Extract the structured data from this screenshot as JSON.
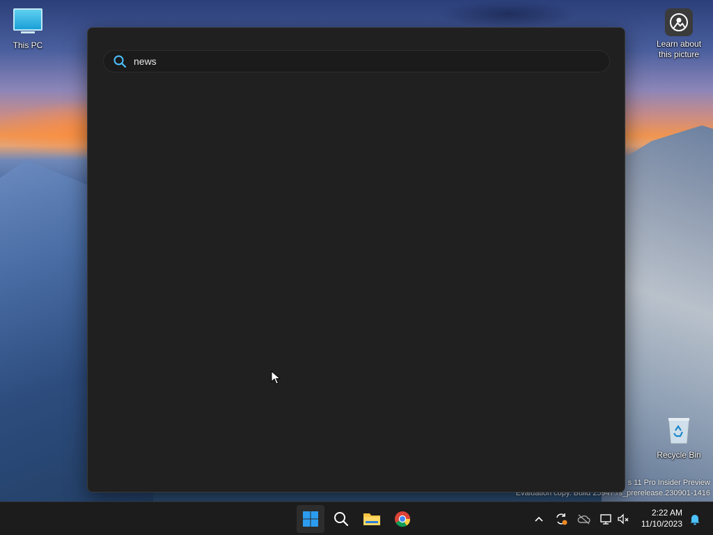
{
  "desktop": {
    "icons": {
      "this_pc": "This PC",
      "learn_line1": "Learn about",
      "learn_line2": "this picture",
      "recycle_bin": "Recycle Bin"
    },
    "watermark": {
      "line1": "s 11 Pro Insider Preview",
      "line2": "Evaluation copy. Build 25947.rs_prerelease.230901-1416"
    }
  },
  "search": {
    "query": "news",
    "accent_color": "#4cc2ff"
  },
  "taskbar": {
    "pinned": [
      "start-icon",
      "search-icon",
      "file-explorer-icon",
      "chrome-icon"
    ],
    "tray": [
      "chevron-up-icon",
      "sync-icon",
      "onedrive-icon",
      "network-icon",
      "volume-muted-icon",
      "notification-bell-icon"
    ],
    "time": "2:22 AM",
    "date": "11/10/2023"
  }
}
